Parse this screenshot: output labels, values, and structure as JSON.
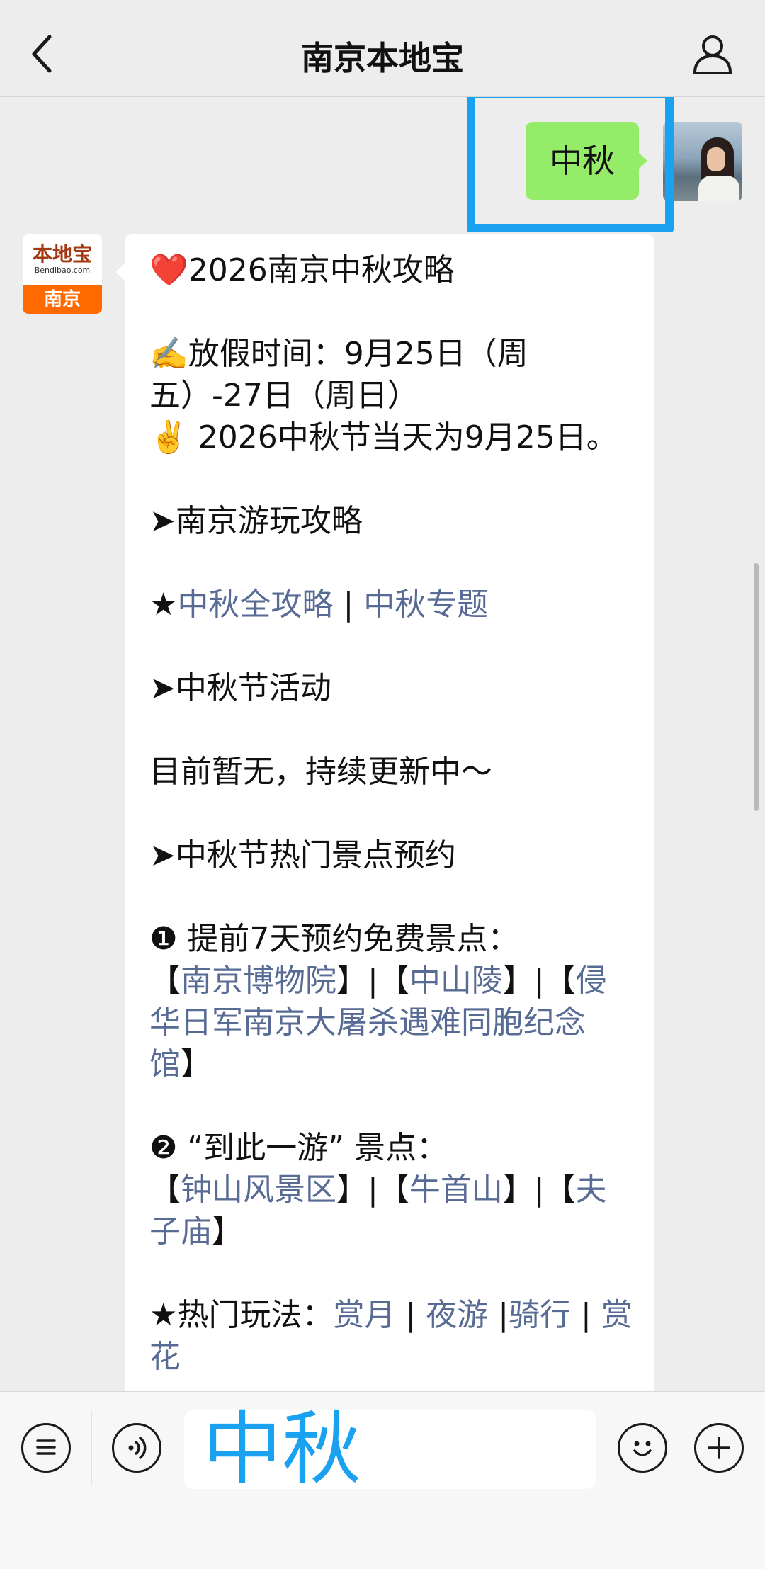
{
  "header": {
    "title": "南京本地宝",
    "back_icon": "chevron-left-icon",
    "profile_icon": "person-icon"
  },
  "sent_message": {
    "text": "中秋"
  },
  "bot": {
    "avatar_brand": "本地宝",
    "avatar_domain": "Bendibao.com",
    "avatar_city": "南京"
  },
  "reply": {
    "title": "❤️2026南京中秋攻略",
    "holiday_line": "✍️放假时间：9月25日（周五）-27日（周日）",
    "festival_line": "✌️ 2026中秋节当天为9月25日。",
    "section1": "➤南京游玩攻略",
    "star": "★",
    "link_all": "中秋全攻略",
    "sep": " | ",
    "link_topic": "中秋专题",
    "section2": "➤中秋节活动",
    "activity_text": "目前暂无，持续更新中～",
    "section3": "➤中秋节热门景点预约",
    "item1_head": "❶ 提前7天预约免费景点：",
    "bracket_open": "【",
    "bracket_close": "】",
    "bracket_sep": "|",
    "item1_links": [
      "南京博物院",
      "中山陵",
      "侵华日军南京大屠杀遇难同胞纪念馆"
    ],
    "item2_head": "❷ “到此一游” 景点：",
    "item2_links": [
      "钟山风景区",
      "牛首山",
      "夫子庙"
    ],
    "hot_head": "★热门玩法：",
    "hot_links": [
      "赏月",
      "夜游",
      "骑行",
      "赏花"
    ],
    "hot_seps": [
      " | ",
      " |",
      " | "
    ]
  },
  "input": {
    "value": "中秋",
    "menu_icon": "list-menu-icon",
    "voice_icon": "voice-icon",
    "emoji_icon": "emoji-icon",
    "plus_icon": "plus-icon"
  },
  "colors": {
    "sent_bubble": "#95ec69",
    "link": "#576b95",
    "highlight": "#1aa1f0",
    "brand_orange": "#ff6a00"
  }
}
